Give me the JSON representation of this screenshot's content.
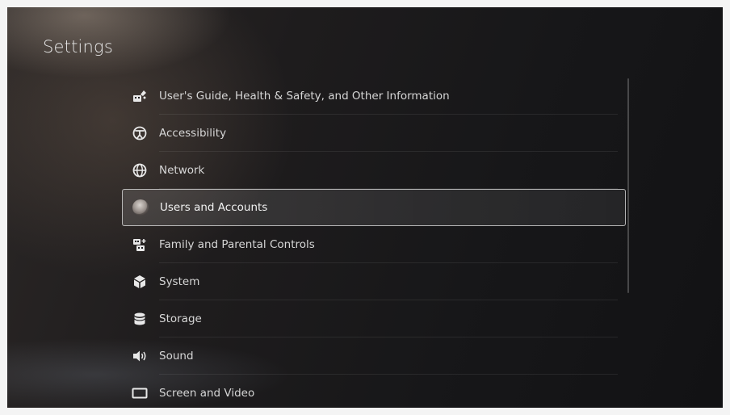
{
  "header": {
    "title": "Settings"
  },
  "menu": {
    "items": [
      {
        "label": "User's Guide, Health & Safety, and Other Information",
        "icon": "guide-icon"
      },
      {
        "label": "Accessibility",
        "icon": "accessibility-icon"
      },
      {
        "label": "Network",
        "icon": "globe-icon"
      },
      {
        "label": "Users and Accounts",
        "icon": "avatar-icon",
        "selected": true
      },
      {
        "label": "Family and Parental Controls",
        "icon": "family-icon"
      },
      {
        "label": "System",
        "icon": "system-cube-icon"
      },
      {
        "label": "Storage",
        "icon": "storage-icon"
      },
      {
        "label": "Sound",
        "icon": "speaker-icon"
      },
      {
        "label": "Screen and Video",
        "icon": "screen-icon"
      }
    ]
  },
  "colors": {
    "text": "#d6d6d6",
    "selected_border": "#e1e1e1",
    "background": "#1a1a1c"
  }
}
